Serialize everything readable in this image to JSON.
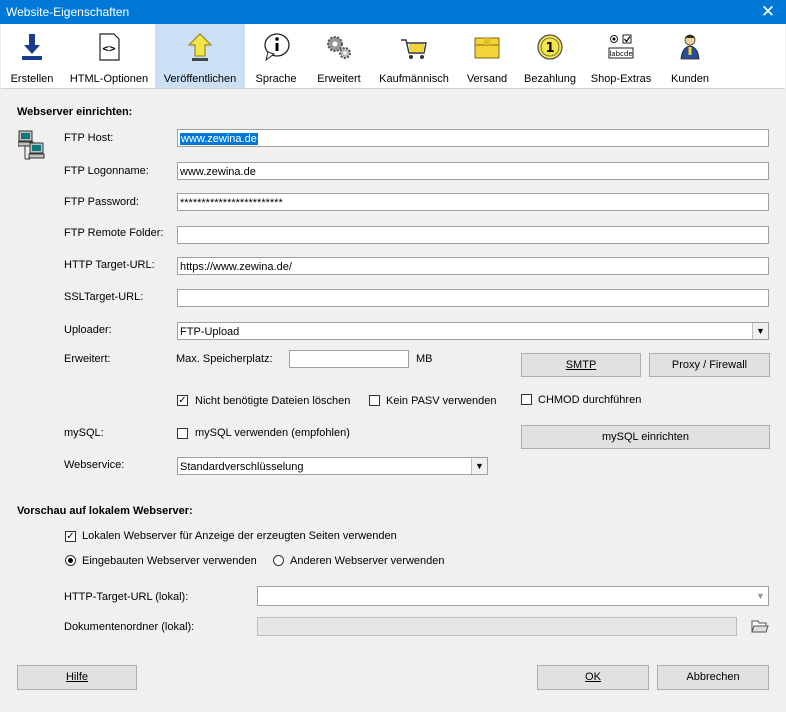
{
  "window": {
    "title": "Website-Eigenschaften",
    "close": "✕"
  },
  "toolbar": [
    {
      "label": "Erstellen",
      "icon": "download-arrow-icon"
    },
    {
      "label": "HTML-Optionen",
      "icon": "html-code-icon"
    },
    {
      "label": "Veröffentlichen",
      "icon": "publish-arrow-icon",
      "active": true
    },
    {
      "label": "Sprache",
      "icon": "info-bubble-icon"
    },
    {
      "label": "Erweitert",
      "icon": "gears-icon"
    },
    {
      "label": "Kaufmännisch",
      "icon": "shopping-cart-icon"
    },
    {
      "label": "Versand",
      "icon": "package-icon"
    },
    {
      "label": "Bezahlung",
      "icon": "coin-icon"
    },
    {
      "label": "Shop-Extras",
      "icon": "checkboxes-icon"
    },
    {
      "label": "Kunden",
      "icon": "customer-icon"
    }
  ],
  "webserver": {
    "heading": "Webserver einrichten:",
    "ftp_host_label": "FTP Host:",
    "ftp_host_value": "www.zewina.de",
    "ftp_logon_label": "FTP Logonname:",
    "ftp_logon_value": "www.zewina.de",
    "ftp_password_label": "FTP Password:",
    "ftp_password_value": "************************",
    "ftp_remote_label": "FTP Remote Folder:",
    "ftp_remote_value": "",
    "http_target_label": "HTTP Target-URL:",
    "http_target_value": "https://www.zewina.de/",
    "ssl_target_label": "SSLTarget-URL:",
    "ssl_target_value": "",
    "uploader_label": "Uploader:",
    "uploader_value": "FTP-Upload",
    "erweitert_label": "Erweitert:",
    "max_speicher_label": "Max. Speicherplatz:",
    "max_speicher_value": "",
    "mb_unit": "MB",
    "smtp_button": "SMTP",
    "proxy_button": "Proxy / Firewall",
    "nicht_benoetigte_label": "Nicht benötigte Dateien löschen",
    "nicht_benoetigte_checked": true,
    "kein_pasv_label": "Kein PASV verwenden",
    "kein_pasv_checked": false,
    "chmod_label": "CHMOD durchführen",
    "chmod_checked": false,
    "mysql_label": "mySQL:",
    "mysql_use_label": "mySQL verwenden (empfohlen)",
    "mysql_use_checked": false,
    "mysql_setup_button": "mySQL einrichten",
    "webservice_label": "Webservice:",
    "webservice_value": "Standardverschlüsselung"
  },
  "preview": {
    "heading": "Vorschau auf lokalem Webserver:",
    "local_checkbox_label": "Lokalen Webserver für Anzeige der erzeugten Seiten verwenden",
    "local_checkbox_checked": true,
    "radio_builtin_label": "Eingebauten Webserver verwenden",
    "radio_other_label": "Anderen Webserver verwenden",
    "radio_selected": "builtin",
    "http_local_label": "HTTP-Target-URL (lokal):",
    "http_local_value": "",
    "doc_folder_label": "Dokumentenordner (lokal):",
    "doc_folder_value": ""
  },
  "footer": {
    "help_button": "Hilfe",
    "ok_button": "OK",
    "cancel_button": "Abbrechen"
  },
  "colors": {
    "titlebar": "#0078d7",
    "selected_tab": "#cce0f5",
    "dialog_bg": "#f0f0f0"
  }
}
